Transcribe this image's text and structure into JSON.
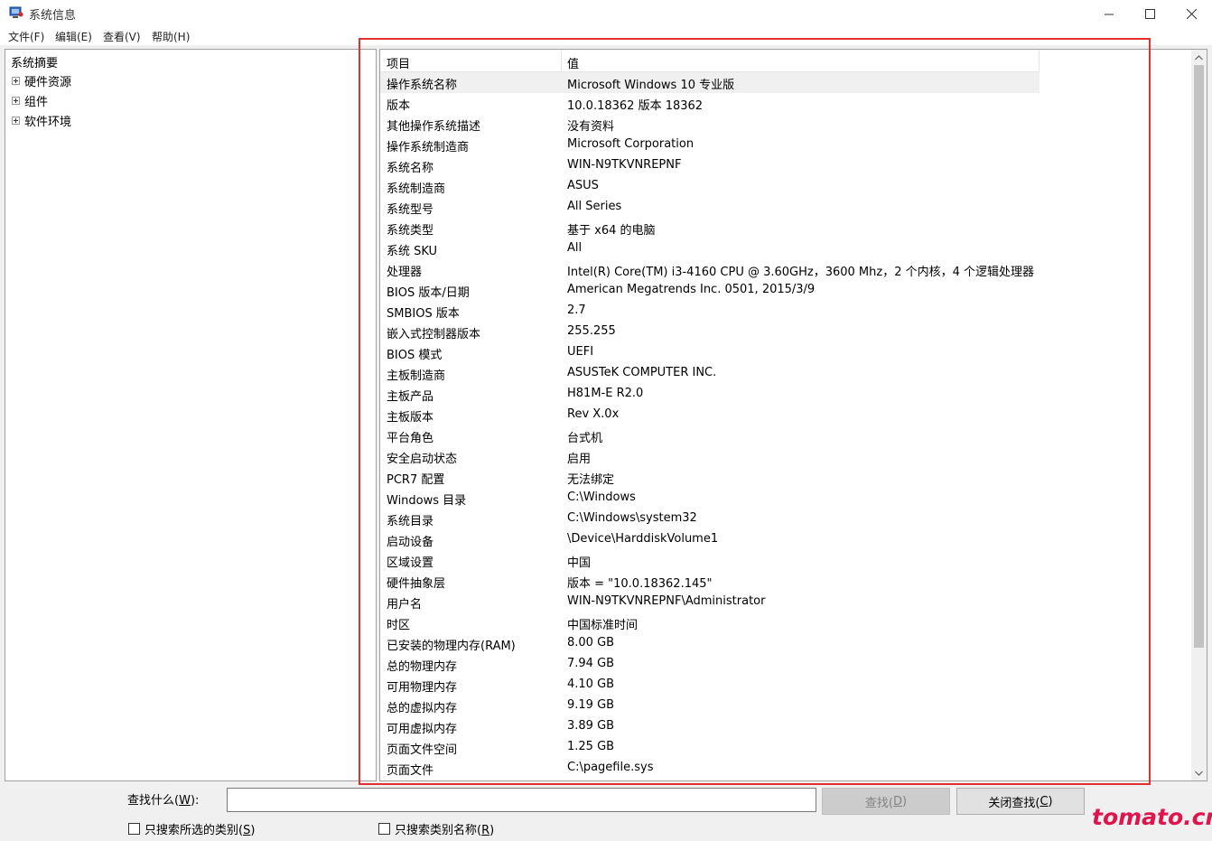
{
  "window": {
    "title": "系统信息",
    "controls": [
      "minimize-icon",
      "maximize-icon",
      "close-icon"
    ]
  },
  "menu": [
    "文件(F)",
    "编辑(E)",
    "查看(V)",
    "帮助(H)"
  ],
  "tree": {
    "root": "系统摘要",
    "items": [
      "硬件资源",
      "组件",
      "软件环境"
    ]
  },
  "table": {
    "headers": [
      "项目",
      "值"
    ],
    "rows": [
      [
        "操作系统名称",
        "Microsoft Windows 10 专业版"
      ],
      [
        "版本",
        "10.0.18362 版本 18362"
      ],
      [
        "其他操作系统描述",
        "没有资料"
      ],
      [
        "操作系统制造商",
        "Microsoft Corporation"
      ],
      [
        "系统名称",
        "WIN-N9TKVNREPNF"
      ],
      [
        "系统制造商",
        "ASUS"
      ],
      [
        "系统型号",
        "All Series"
      ],
      [
        "系统类型",
        "基于 x64 的电脑"
      ],
      [
        "系统 SKU",
        "All"
      ],
      [
        "处理器",
        "Intel(R) Core(TM) i3-4160 CPU @ 3.60GHz，3600 Mhz，2 个内核，4 个逻辑处理器"
      ],
      [
        "BIOS 版本/日期",
        "American Megatrends Inc. 0501, 2015/3/9"
      ],
      [
        "SMBIOS 版本",
        "2.7"
      ],
      [
        "嵌入式控制器版本",
        "255.255"
      ],
      [
        "BIOS 模式",
        "UEFI"
      ],
      [
        "主板制造商",
        "ASUSTeK COMPUTER INC."
      ],
      [
        "主板产品",
        "H81M-E R2.0"
      ],
      [
        "主板版本",
        "Rev X.0x"
      ],
      [
        "平台角色",
        "台式机"
      ],
      [
        "安全启动状态",
        "启用"
      ],
      [
        "PCR7 配置",
        "无法绑定"
      ],
      [
        "Windows 目录",
        "C:\\Windows"
      ],
      [
        "系统目录",
        "C:\\Windows\\system32"
      ],
      [
        "启动设备",
        "\\Device\\HarddiskVolume1"
      ],
      [
        "区域设置",
        "中国"
      ],
      [
        "硬件抽象层",
        "版本 = \"10.0.18362.145\""
      ],
      [
        "用户名",
        "WIN-N9TKVNREPNF\\Administrator"
      ],
      [
        "时区",
        "中国标准时间"
      ],
      [
        "已安装的物理内存(RAM)",
        "8.00 GB"
      ],
      [
        "总的物理内存",
        "7.94 GB"
      ],
      [
        "可用物理内存",
        "4.10 GB"
      ],
      [
        "总的虚拟内存",
        "9.19 GB"
      ],
      [
        "可用虚拟内存",
        "3.89 GB"
      ],
      [
        "页面文件空间",
        "1.25 GB"
      ],
      [
        "页面文件",
        "C:\\pagefile.sys"
      ]
    ],
    "selected_row": 0
  },
  "find": {
    "label": "查找什么(W):",
    "label_pre": "查找什么(",
    "label_key": "W",
    "label_post": "):",
    "input_value": "",
    "find_button": {
      "pre": "查找(",
      "key": "D",
      "post": ")"
    },
    "close_button": {
      "pre": "关闭查找(",
      "key": "C",
      "post": ")"
    },
    "check1": {
      "pre": "只搜索所选的类别(",
      "key": "S",
      "post": ")"
    },
    "check2": {
      "pre": "只搜索类别名称(",
      "key": "R",
      "post": ")"
    }
  },
  "watermark": "tomato.cm",
  "colors": {
    "highlight": "#e53030",
    "watermark": "#e0144c"
  }
}
